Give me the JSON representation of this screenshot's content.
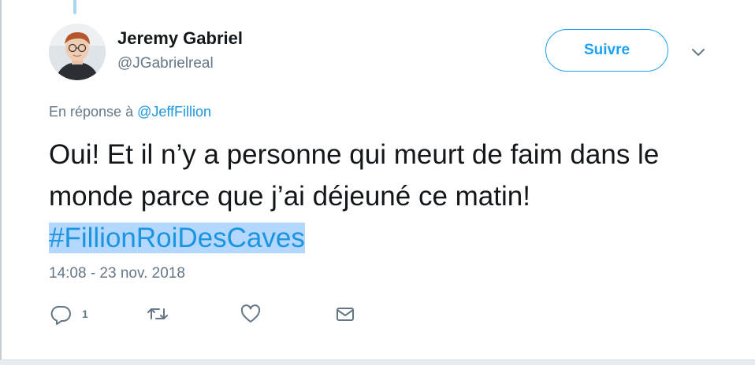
{
  "user": {
    "name": "Jeremy Gabriel",
    "handle": "@JGabrielreal"
  },
  "follow_button_label": "Suivre",
  "reply_to": {
    "prefix": "En réponse à",
    "mention": "@JeffFillion"
  },
  "tweet": {
    "text": "Oui! Et il n’y a personne qui meurt de faim dans le monde parce que j’ai déjeuné ce matin!",
    "hashtag": "#FillionRoiDesCaves"
  },
  "timestamp": "14:08 - 23 nov. 2018",
  "actions": {
    "reply_count": "1",
    "reply_icon": "reply-icon",
    "retweet_icon": "retweet-icon",
    "like_icon": "heart-icon",
    "dm_icon": "envelope-icon"
  },
  "colors": {
    "accent": "#1da1f2",
    "link": "#1b95e0",
    "hashtag_highlight": "#b3d7fd",
    "secondary_text": "#657786"
  }
}
